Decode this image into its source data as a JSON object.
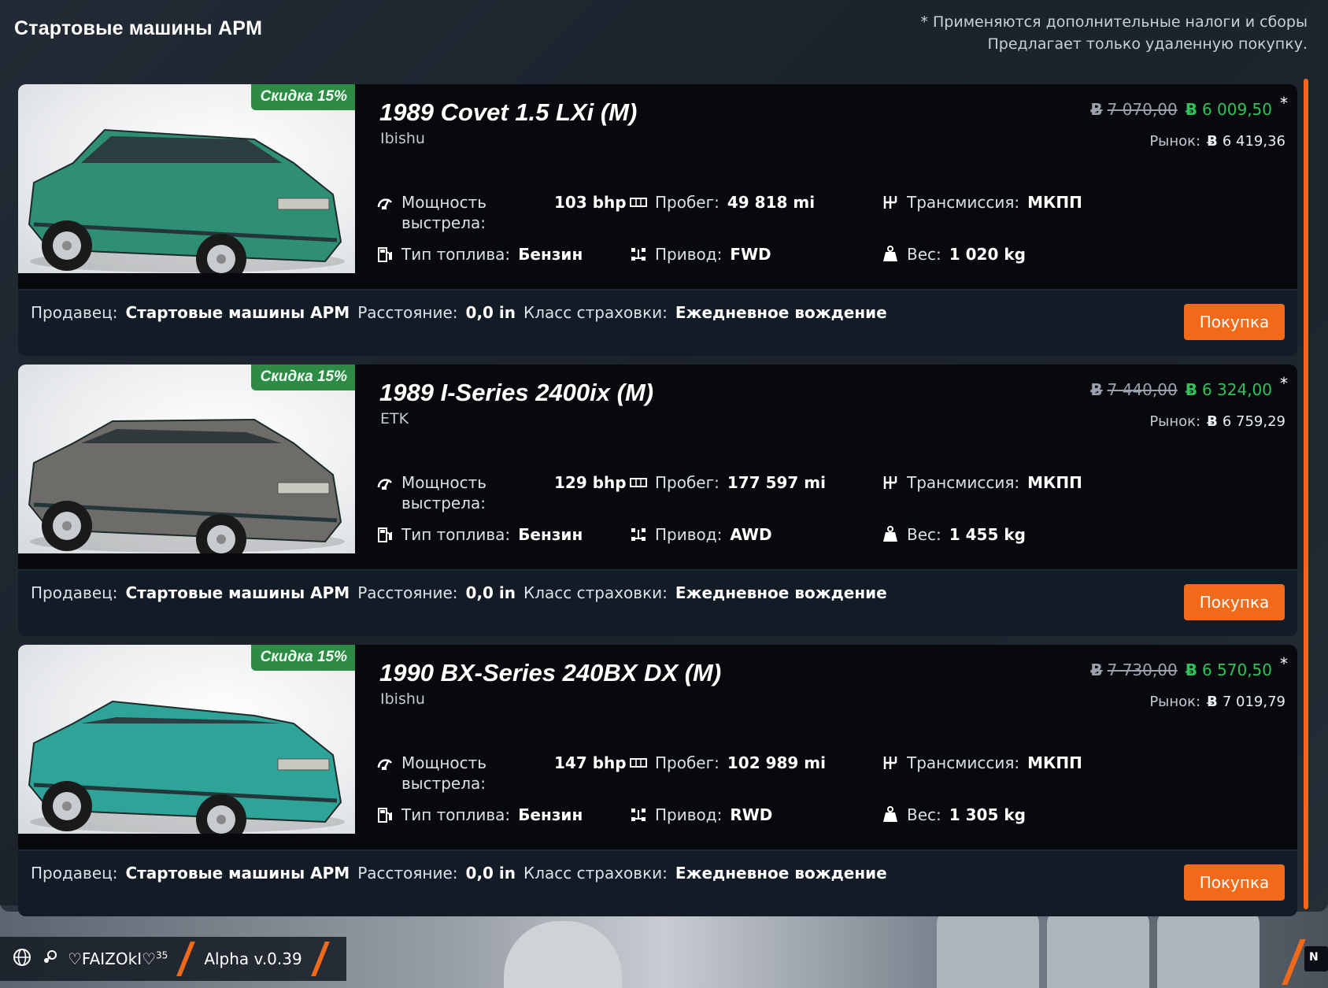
{
  "panel": {
    "title": "Стартовые машины APM",
    "note_line1": "* Применяются дополнительные налоги и сборы",
    "note_line2": "Предлагает только удаленную покупку."
  },
  "labels": {
    "power_line1": "Мощность",
    "power_line2": "выстрела:",
    "mileage": "Пробег:",
    "transmission": "Трансмиссия:",
    "fuel_type": "Тип топлива:",
    "drive": "Привод:",
    "weight": "Вес:",
    "market": "Рынок:",
    "seller": "Продавец:",
    "distance": "Расстояние:",
    "insurance": "Класс страховки:",
    "buy": "Покупка",
    "asterisk": "*",
    "currency_symbol": "Ƀ"
  },
  "cars": [
    {
      "discount": "Скидка 15%",
      "name": "1989 Covet 1.5 LXi (M)",
      "make": "Ibishu",
      "old_price": "7 070,00",
      "new_price": "6 009,50",
      "market_price": "6 419,36",
      "power": "103 bhp",
      "mileage": "49 818 mi",
      "transmission": "МКПП",
      "fuel": "Бензин",
      "drive": "FWD",
      "weight": "1 020 kg",
      "seller": "Стартовые машины APM",
      "distance": "0,0 in",
      "insurance": "Ежедневное вождение",
      "body_color": "#2f8f74",
      "style": "hatch"
    },
    {
      "discount": "Скидка 15%",
      "name": "1989 I-Series 2400ix (M)",
      "make": "ETK",
      "old_price": "7 440,00",
      "new_price": "6 324,00",
      "market_price": "6 759,29",
      "power": "129 bhp",
      "mileage": "177 597 mi",
      "transmission": "МКПП",
      "fuel": "Бензин",
      "drive": "AWD",
      "weight": "1 455 kg",
      "seller": "Стартовые машины APM",
      "distance": "0,0 in",
      "insurance": "Ежедневное вождение",
      "body_color": "#6e6c69",
      "style": "sedan"
    },
    {
      "discount": "Скидка 15%",
      "name": "1990 BX-Series 240BX DX (M)",
      "make": "Ibishu",
      "old_price": "7 730,00",
      "new_price": "6 570,50",
      "market_price": "7 019,79",
      "power": "147 bhp",
      "mileage": "102 989 mi",
      "transmission": "МКПП",
      "fuel": "Бензин",
      "drive": "RWD",
      "weight": "1 305 kg",
      "seller": "Стартовые машины APM",
      "distance": "0,0 in",
      "insurance": "Ежедневное вождение",
      "body_color": "#2ea398",
      "style": "coupe"
    }
  ],
  "statusbar": {
    "username": "♡FAIZOkI♡",
    "level": "35",
    "version": "Alpha v.0.39",
    "corner": "N"
  },
  "colors": {
    "accent": "#f06a1a",
    "discount_green": "#2e8b45",
    "new_price_green": "#34c05a"
  }
}
